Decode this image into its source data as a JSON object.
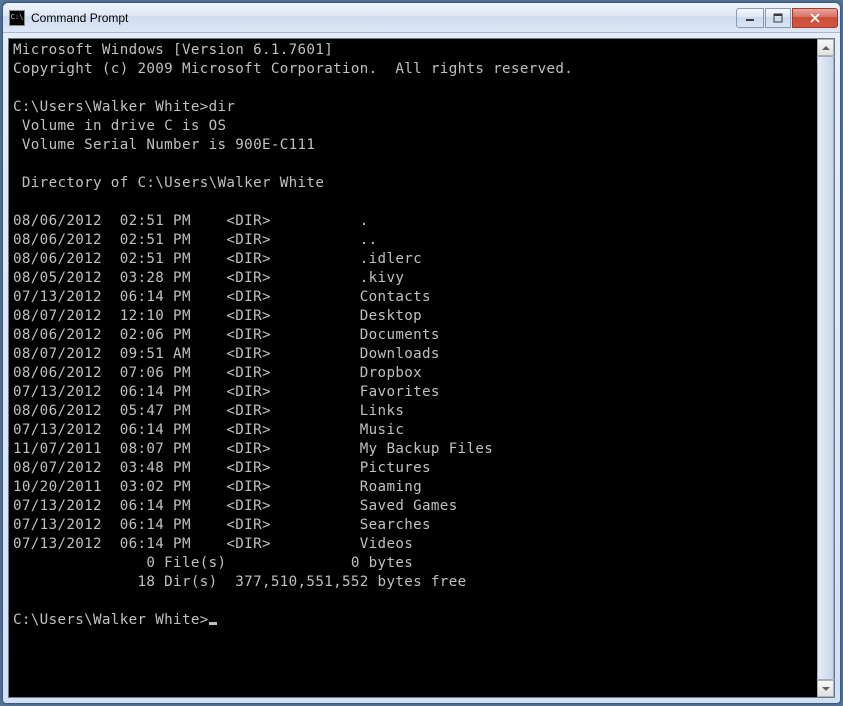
{
  "window": {
    "title": "Command Prompt"
  },
  "header": {
    "line1": "Microsoft Windows [Version 6.1.7601]",
    "line2": "Copyright (c) 2009 Microsoft Corporation.  All rights reserved."
  },
  "prompt1": {
    "path": "C:\\Users\\Walker White>",
    "command": "dir"
  },
  "volume": {
    "drive": " Volume in drive C is OS",
    "serial": " Volume Serial Number is 900E-C111"
  },
  "directory_header": " Directory of C:\\Users\\Walker White",
  "entries": [
    {
      "date": "08/06/2012",
      "time": "02:51 PM",
      "type": "<DIR>",
      "name": "."
    },
    {
      "date": "08/06/2012",
      "time": "02:51 PM",
      "type": "<DIR>",
      "name": ".."
    },
    {
      "date": "08/06/2012",
      "time": "02:51 PM",
      "type": "<DIR>",
      "name": ".idlerc"
    },
    {
      "date": "08/05/2012",
      "time": "03:28 PM",
      "type": "<DIR>",
      "name": ".kivy"
    },
    {
      "date": "07/13/2012",
      "time": "06:14 PM",
      "type": "<DIR>",
      "name": "Contacts"
    },
    {
      "date": "08/07/2012",
      "time": "12:10 PM",
      "type": "<DIR>",
      "name": "Desktop"
    },
    {
      "date": "08/06/2012",
      "time": "02:06 PM",
      "type": "<DIR>",
      "name": "Documents"
    },
    {
      "date": "08/07/2012",
      "time": "09:51 AM",
      "type": "<DIR>",
      "name": "Downloads"
    },
    {
      "date": "08/06/2012",
      "time": "07:06 PM",
      "type": "<DIR>",
      "name": "Dropbox"
    },
    {
      "date": "07/13/2012",
      "time": "06:14 PM",
      "type": "<DIR>",
      "name": "Favorites"
    },
    {
      "date": "08/06/2012",
      "time": "05:47 PM",
      "type": "<DIR>",
      "name": "Links"
    },
    {
      "date": "07/13/2012",
      "time": "06:14 PM",
      "type": "<DIR>",
      "name": "Music"
    },
    {
      "date": "11/07/2011",
      "time": "08:07 PM",
      "type": "<DIR>",
      "name": "My Backup Files"
    },
    {
      "date": "08/07/2012",
      "time": "03:48 PM",
      "type": "<DIR>",
      "name": "Pictures"
    },
    {
      "date": "10/20/2011",
      "time": "03:02 PM",
      "type": "<DIR>",
      "name": "Roaming"
    },
    {
      "date": "07/13/2012",
      "time": "06:14 PM",
      "type": "<DIR>",
      "name": "Saved Games"
    },
    {
      "date": "07/13/2012",
      "time": "06:14 PM",
      "type": "<DIR>",
      "name": "Searches"
    },
    {
      "date": "07/13/2012",
      "time": "06:14 PM",
      "type": "<DIR>",
      "name": "Videos"
    }
  ],
  "summary": {
    "files": "               0 File(s)              0 bytes",
    "dirs": "              18 Dir(s)  377,510,551,552 bytes free"
  },
  "prompt2": {
    "path": "C:\\Users\\Walker White>"
  }
}
